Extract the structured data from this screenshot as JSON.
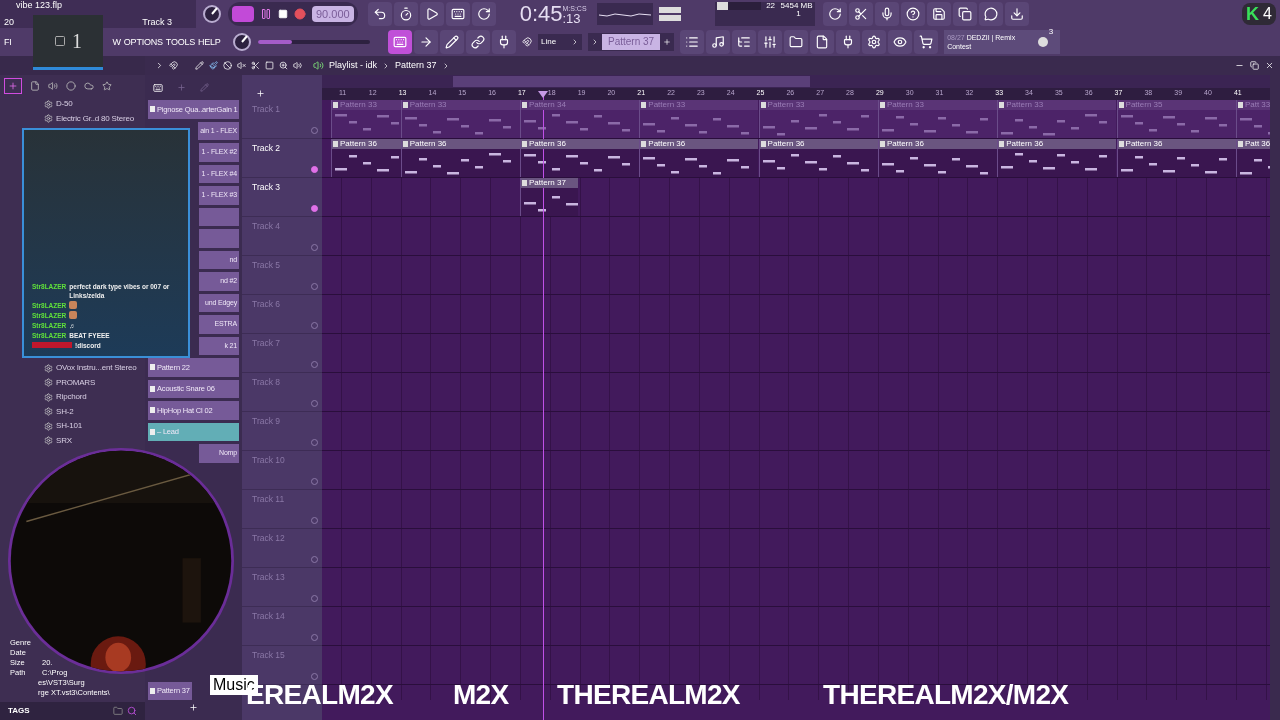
{
  "project": {
    "title": "vibe 123.flp",
    "number": "20",
    "target": "Track 3"
  },
  "counter_overlay": {
    "value": "1"
  },
  "menu": [
    "FI",
    "W",
    "OPTIONS",
    "TOOLS",
    "HELP"
  ],
  "transport": {
    "song_mode": true,
    "tempo": "90.000"
  },
  "master_pitch": {
    "level": 0.3
  },
  "clock": {
    "main": "0:45",
    "small": ":13",
    "unit": "M:S:CS"
  },
  "cpu": {
    "level": 0.25,
    "polyphony": "22",
    "memory": "5454 MB",
    "voices": "1"
  },
  "snap": {
    "value": "Line"
  },
  "pattern_selector": {
    "value": "Pattern 37"
  },
  "news": {
    "date": "08/27",
    "headline": "DEDZII | Remix Contest",
    "count": "3"
  },
  "stream_badge": {
    "letter": "K",
    "count": "4"
  },
  "browser": {
    "items": [
      {
        "name": "D-50"
      },
      {
        "name": "Electric Gr..d 80 Stereo"
      },
      {
        "name": "OVox Instru...ent Stereo"
      },
      {
        "name": "PROMARS"
      },
      {
        "name": "Ripchord"
      },
      {
        "name": "SH-2"
      },
      {
        "name": "SH-101"
      },
      {
        "name": "SRX"
      }
    ],
    "info": [
      {
        "label": "Genre"
      },
      {
        "label": "Date"
      },
      {
        "label": "Size",
        "value": "20."
      },
      {
        "label": "Path",
        "value": "C:\\Prog"
      }
    ],
    "path_lines": [
      "es\\VST3\\Surg",
      "rge XT.vst3\\Contents\\"
    ],
    "tags_label": "TAGS"
  },
  "patterns": [
    {
      "name": "Pignose Qua..arterGain 1",
      "selected": false,
      "covered": false
    },
    {
      "name": "ain 1 - FLEX",
      "selected": false,
      "covered": true
    },
    {
      "name": "1 - FLEX #2",
      "selected": false,
      "covered": true
    },
    {
      "name": "1 - FLEX #4",
      "selected": false,
      "covered": true
    },
    {
      "name": "1 - FLEX #3",
      "selected": false,
      "covered": true
    },
    {
      "selected": false,
      "covered": true
    },
    {
      "selected": false,
      "covered": true
    },
    {
      "name": "nd",
      "selected": false,
      "covered": true
    },
    {
      "name": "nd #2",
      "selected": false,
      "covered": true
    },
    {
      "name": "und Edgey",
      "selected": false,
      "covered": true
    },
    {
      "name": "ESTRA",
      "selected": false,
      "covered": true
    },
    {
      "name": "k 21",
      "selected": false,
      "covered": true
    },
    {
      "name": "Pattern 22",
      "selected": false,
      "covered": false
    },
    {
      "name": "Acoustic Snare 06",
      "selected": false,
      "covered": false
    },
    {
      "name": "HipHop Hat Cl 02",
      "selected": false,
      "covered": false
    },
    {
      "name": "– Lead",
      "selected": true,
      "covered": false
    },
    {
      "name": "Nomp",
      "selected": false,
      "covered": true
    },
    {
      "name": "Pattern 37",
      "selected": false,
      "covered": false
    }
  ],
  "playlist": {
    "title": "Playlist - idk",
    "pattern": "Pattern 37",
    "ruler": [
      "11",
      "12",
      "13",
      "14",
      "15",
      "16",
      "17",
      "18",
      "19",
      "20",
      "21",
      "22",
      "23",
      "24",
      "25",
      "26",
      "27",
      "28",
      "29",
      "30",
      "31",
      "32",
      "33",
      "34",
      "35",
      "36",
      "37",
      "38",
      "39",
      "40",
      "41"
    ],
    "tracks": [
      {
        "name": "Track 1",
        "dimmed": true,
        "clips": [
          "Pattern 33",
          "Pattern 33",
          "Pattern 34",
          "Pattern 33",
          "Pattern 33",
          "Pattern 33",
          "Pattern 33",
          "Pattern 35",
          "Patt 33"
        ]
      },
      {
        "name": "Track 2",
        "dimmed": false,
        "clips": [
          "Pattern 36",
          "Pattern 36",
          "Pattern 36",
          "Pattern 36",
          "Pattern 36",
          "Pattern 36",
          "Pattern 36",
          "Pattern 36",
          "Patt 36"
        ]
      },
      {
        "name": "Track 3",
        "dimmed": false,
        "clips": [
          "Pattern 37"
        ]
      },
      {
        "name": "Track 4",
        "dimmed": true
      },
      {
        "name": "Track 5",
        "dimmed": true
      },
      {
        "name": "Track 6",
        "dimmed": true
      },
      {
        "name": "Track 7",
        "dimmed": true
      },
      {
        "name": "Track 8",
        "dimmed": true
      },
      {
        "name": "Track 9",
        "dimmed": true
      },
      {
        "name": "Track 10",
        "dimmed": true
      },
      {
        "name": "Track 11",
        "dimmed": true
      },
      {
        "name": "Track 12",
        "dimmed": true
      },
      {
        "name": "Track 13",
        "dimmed": true
      },
      {
        "name": "Track 14",
        "dimmed": true
      },
      {
        "name": "Track 15",
        "dimmed": true
      }
    ]
  },
  "chat": [
    {
      "user": "Str8LAZER",
      "color": "#5fe03a",
      "text": "perfect dark type vibes or 007 or Links/zelda",
      "emote": false
    },
    {
      "user": "Str8LAZER",
      "color": "#5fe03a",
      "emote": true
    },
    {
      "user": "Str8LAZER",
      "color": "#5fe03a",
      "emote": true
    },
    {
      "user": "Str8LAZER",
      "color": "#5fe03a",
      "text": "♬",
      "emote": false
    },
    {
      "user": "Str8LAZER",
      "color": "#5fe03a",
      "text": "BEAT FYEEE",
      "emote": false
    },
    {
      "color": "#c0172c",
      "text": "!discord",
      "emote": false
    }
  ],
  "banner": {
    "logo": "Music",
    "texts": [
      "EREALM2X",
      "M2X",
      "THEREALM2X",
      "THEREALM2X/M2X"
    ]
  }
}
